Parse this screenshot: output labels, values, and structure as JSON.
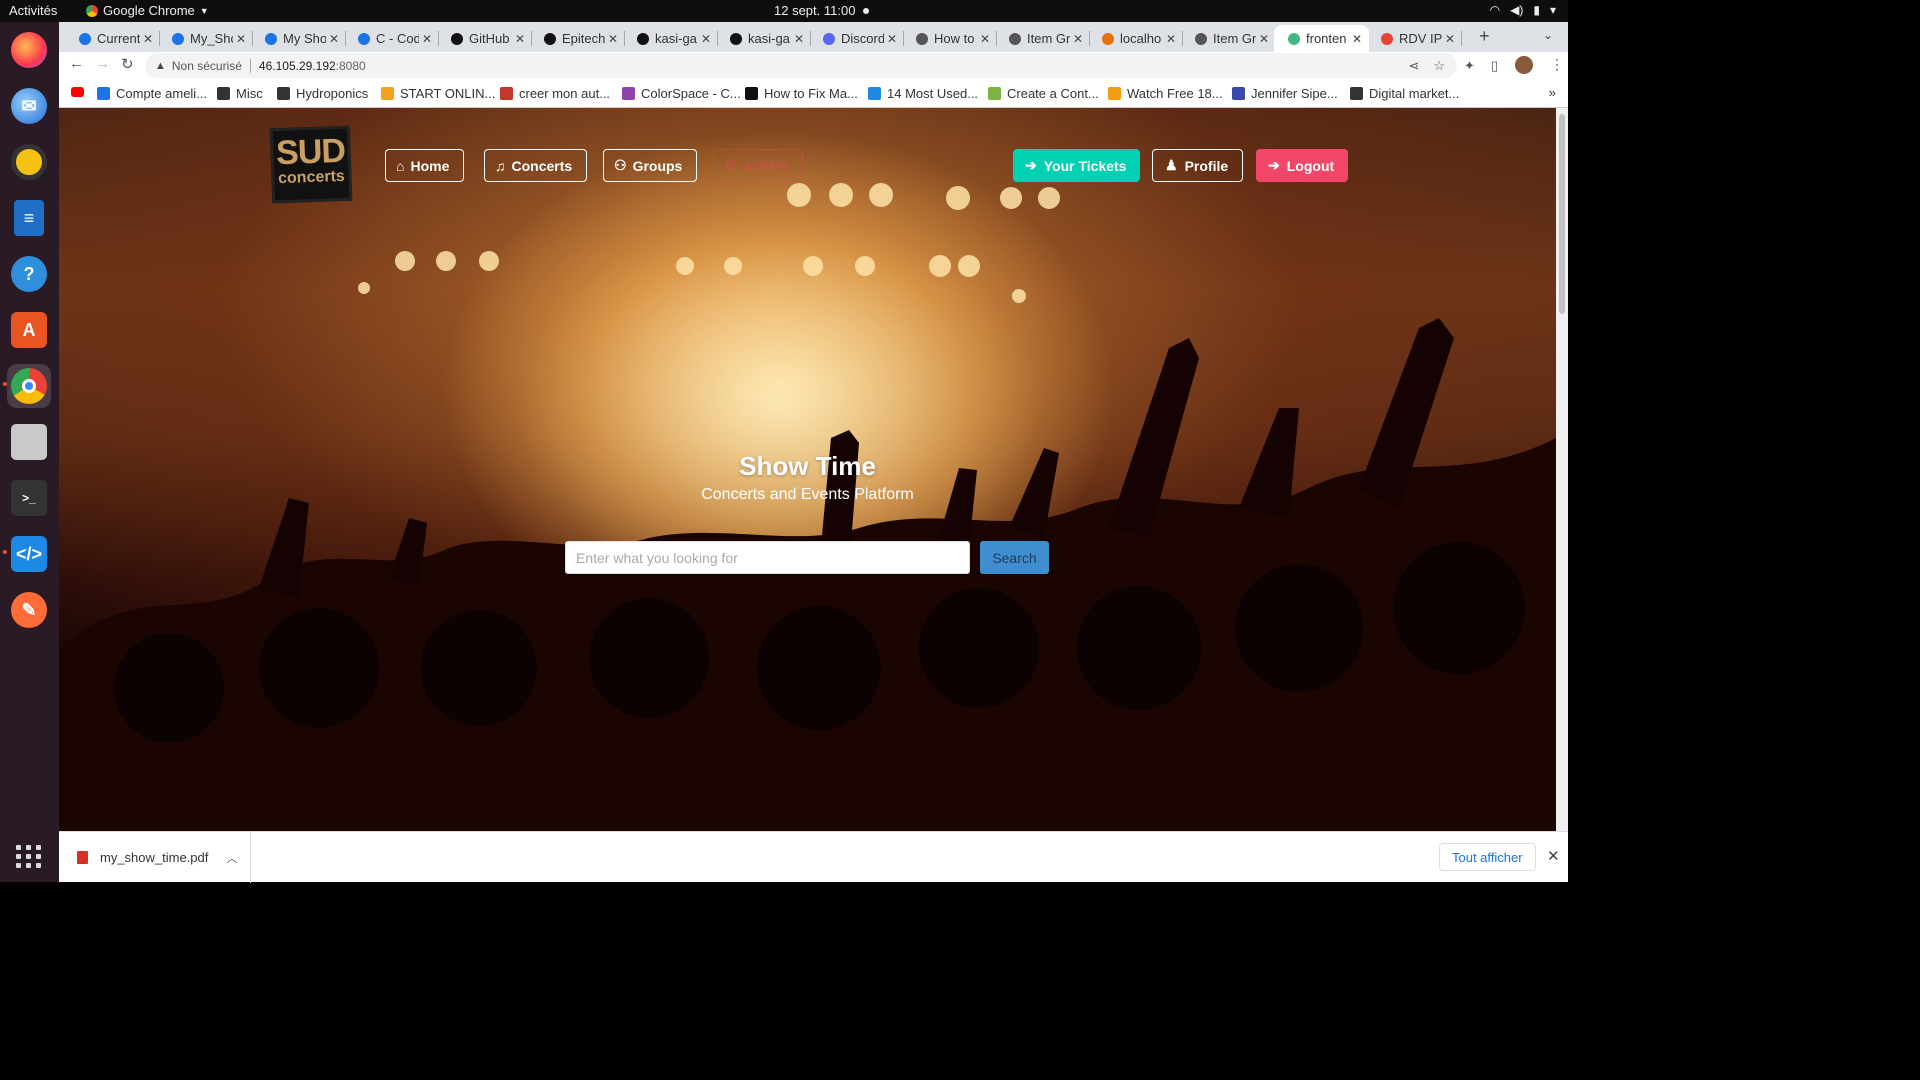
{
  "os": {
    "activities": "Activités",
    "app_name": "Google Chrome",
    "clock": "12 sept.  11:00"
  },
  "browser": {
    "tabs": [
      {
        "label": "Current",
        "color": "#1a73e8"
      },
      {
        "label": "My_Sho",
        "color": "#1a73e8"
      },
      {
        "label": "My Sho",
        "color": "#1a73e8"
      },
      {
        "label": "C - Code",
        "color": "#1a73e8"
      },
      {
        "label": "GitHub",
        "color": "#111111"
      },
      {
        "label": "Epitech",
        "color": "#111111"
      },
      {
        "label": "kasi-ga",
        "color": "#111111"
      },
      {
        "label": "kasi-ga",
        "color": "#111111"
      },
      {
        "label": "Discord",
        "color": "#5865f2"
      },
      {
        "label": "How to",
        "color": "#555555"
      },
      {
        "label": "Item Gr",
        "color": "#555555"
      },
      {
        "label": "localho",
        "color": "#e8710a"
      },
      {
        "label": "Item Gr",
        "color": "#555555"
      },
      {
        "label": "fronten",
        "color": "#42b883"
      },
      {
        "label": "RDV IP",
        "color": "#ea4335"
      }
    ],
    "address": {
      "security_label": "Non sécurisé",
      "host": "46.105.29.192",
      "port": ":8080"
    },
    "bookmarks": [
      {
        "label": "Compte ameli...",
        "color": "#1a73e8"
      },
      {
        "label": "Misc",
        "color": "#333333"
      },
      {
        "label": "Hydroponics",
        "color": "#333333"
      },
      {
        "label": "START ONLIN...",
        "color": "#f4a020"
      },
      {
        "label": "creer mon aut...",
        "color": "#c0392b"
      },
      {
        "label": "ColorSpace - C...",
        "color": "#8e44ad"
      },
      {
        "label": "How to Fix Ma...",
        "color": "#111111"
      },
      {
        "label": "14 Most Used...",
        "color": "#1e88e5"
      },
      {
        "label": "Create a Cont...",
        "color": "#7cb342"
      },
      {
        "label": "Watch Free 18...",
        "color": "#f39c12"
      },
      {
        "label": "Jennifer Sipe...",
        "color": "#3949ab"
      },
      {
        "label": "Digital market...",
        "color": "#333333"
      }
    ]
  },
  "site": {
    "logo_line1": "SUD",
    "logo_line2": "concerts",
    "nav": {
      "home": "Home",
      "concerts": "Concerts",
      "groups": "Groups",
      "admin": "ADMIN"
    },
    "actions": {
      "tickets": "Your Tickets",
      "profile": "Profile",
      "logout": "Logout"
    },
    "hero": {
      "title": "Show Time",
      "subtitle": "Concerts and Events Platform",
      "search_placeholder": "Enter what you looking for",
      "search_button": "Search"
    }
  },
  "downloads": {
    "file": "my_show_time.pdf",
    "show_all": "Tout afficher"
  }
}
